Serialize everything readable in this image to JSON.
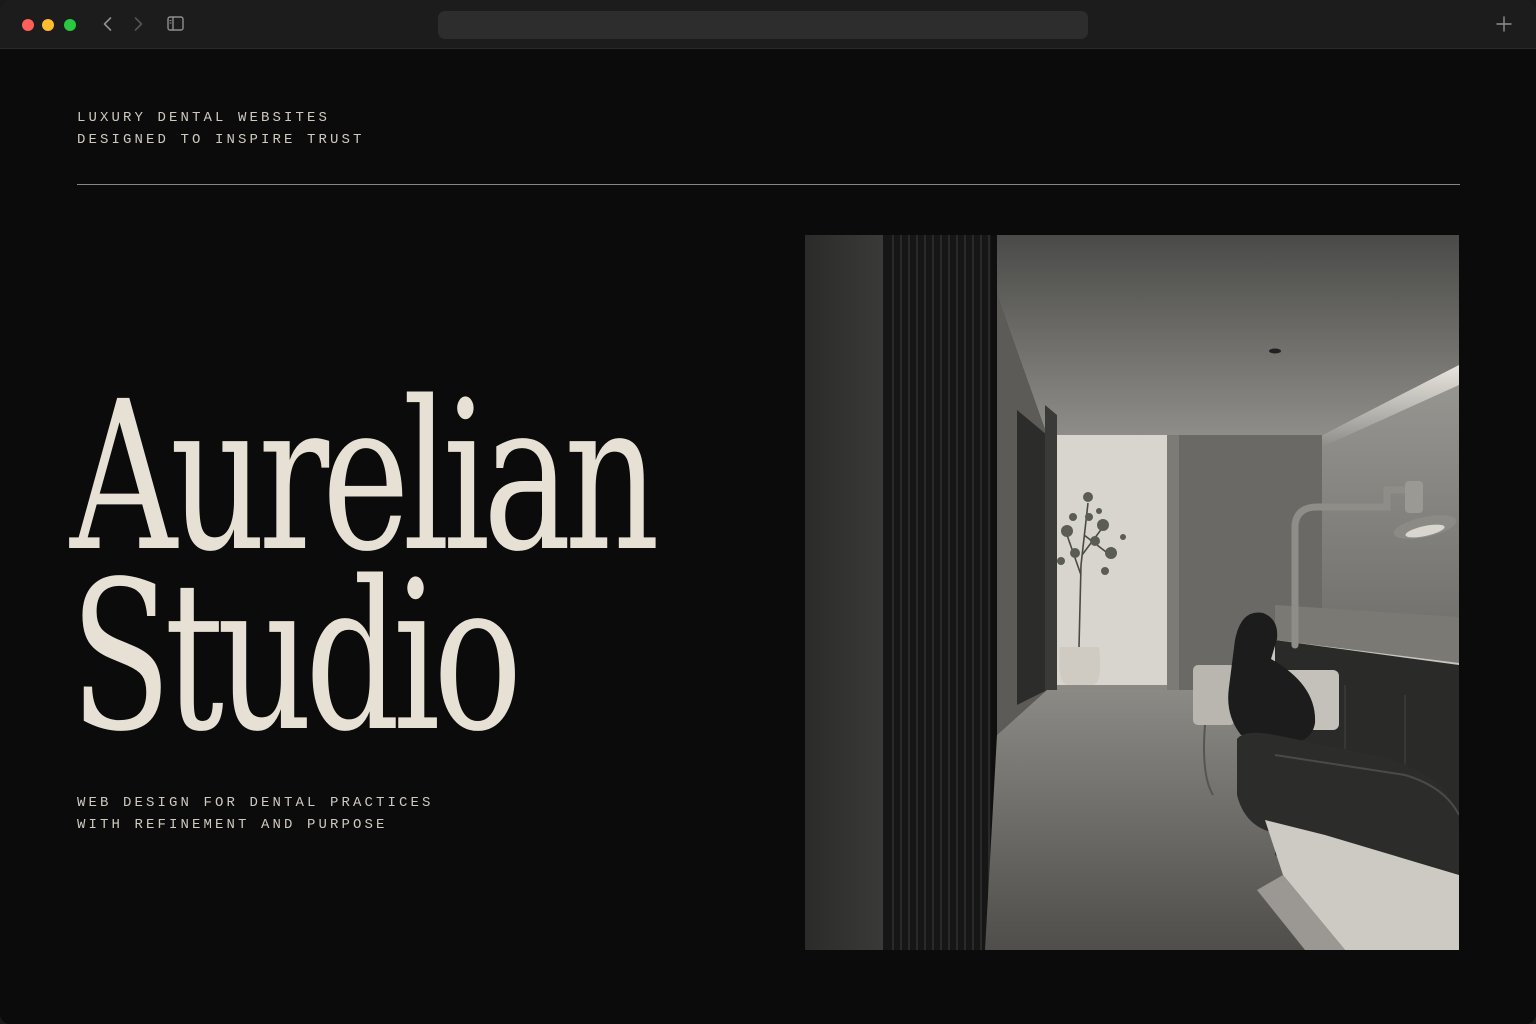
{
  "browser": {
    "address_text": "",
    "icons": {
      "back": "chevron-left-icon",
      "forward": "chevron-right-icon",
      "sidebar": "sidebar-icon",
      "new_tab": "plus-icon"
    }
  },
  "hero": {
    "tagline_line1": "LUXURY DENTAL WEBSITES",
    "tagline_line2": "DESIGNED TO INSPIRE TRUST",
    "title_line1": "Aurelian",
    "title_line2": "Studio",
    "subline_line1": "WEB DESIGN FOR DENTAL PRACTICES",
    "subline_line2": "WITH REFINEMENT AND PURPOSE"
  },
  "colors": {
    "background": "#0b0b0b",
    "title": "#e7e0d4",
    "body_text": "#cfc9c0",
    "rule": "#8a8782"
  }
}
